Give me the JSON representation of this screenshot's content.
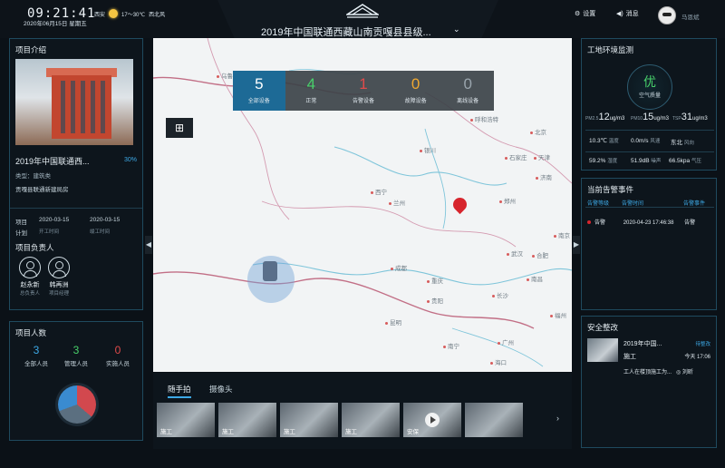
{
  "header": {
    "time": "09:21:41",
    "date": "2020年06月15日 星期五",
    "weather": {
      "city": "西安",
      "temp": "17～30℃",
      "wind": "西北风"
    },
    "title": "2019年中国联通西藏山南贡嘎县县级...",
    "settings_label": "设置",
    "messages_label": "消息",
    "user_name": "马恩斌"
  },
  "project": {
    "panel_title": "项目介绍",
    "name": "2019年中国联通西...",
    "progress": "30%",
    "type": "类型：建筑类",
    "unit": "贡嘎县联通新建局房",
    "item_label": "项目",
    "plan_label": "计划",
    "start_date": "2020-03-15",
    "start_label": "开工时间",
    "end_date": "2020-03-15",
    "end_label": "竣工时间",
    "leaders_title": "项目负责人",
    "leaders": [
      {
        "name": "赵永新",
        "role": "总负责人"
      },
      {
        "name": "韩再洲",
        "role": "项目经理"
      }
    ]
  },
  "people": {
    "panel_title": "项目人数",
    "counts": [
      {
        "value": "3",
        "label": "全部人员",
        "color": "#3da9e6"
      },
      {
        "value": "3",
        "label": "管理人员",
        "color": "#48d06a"
      },
      {
        "value": "0",
        "label": "实施人员",
        "color": "#e04a4a"
      }
    ]
  },
  "device_stats": [
    {
      "value": "5",
      "label": "全部设备",
      "color": "#ffffff"
    },
    {
      "value": "4",
      "label": "正常",
      "color": "#48d06a"
    },
    {
      "value": "1",
      "label": "告警设备",
      "color": "#e04a4a"
    },
    {
      "value": "0",
      "label": "故障设备",
      "color": "#f0a830"
    },
    {
      "value": "0",
      "label": "离线设备",
      "color": "#9aa5ad"
    }
  ],
  "map": {
    "cities": [
      "乌鲁木齐",
      "呼和浩特",
      "北京",
      "天津",
      "石家庄",
      "银川",
      "济南",
      "西宁",
      "兰州",
      "郑州",
      "成都",
      "重庆",
      "武汉",
      "南京",
      "长沙",
      "贵阳",
      "昆明",
      "南宁",
      "广州",
      "福州",
      "南昌",
      "合肥",
      "海口"
    ]
  },
  "media": {
    "tabs": [
      "随手拍",
      "摄像头"
    ],
    "thumbs": [
      "施工",
      "施工",
      "施工",
      "施工",
      "安保",
      ""
    ]
  },
  "environment": {
    "panel_title": "工地环境监测",
    "air_quality_value": "优",
    "air_quality_label": "空气质量",
    "pm25": "12",
    "pm10": "15",
    "pm_other": "31",
    "pm_unit": "ug/m3",
    "pm25_label": "PM2.5",
    "pm10_label": "PM10",
    "tsp_label": "TSP",
    "temperature": "10.3℃",
    "temperature_label": "温度",
    "wind_speed": "0.0m/s",
    "wind_speed_label": "风速",
    "wind_dir": "东北",
    "wind_dir_label": "风向",
    "humidity": "59.2%",
    "humidity_label": "湿度",
    "noise": "51.9dB",
    "noise_label": "噪声",
    "pressure": "66.5kpa",
    "pressure_label": "气压"
  },
  "alarms": {
    "panel_title": "当前告警事件",
    "headers": [
      "告警等级",
      "告警时间",
      "告警事件"
    ],
    "rows": [
      {
        "level": "告警",
        "time": "2020-04-23 17:46:38",
        "event": "告警"
      }
    ]
  },
  "safety": {
    "panel_title": "安全整改",
    "items": [
      {
        "title": "2019年中国...",
        "status": "待整改",
        "type": "施工",
        "time": "今天 17:06",
        "desc": "工人在楼顶施工为...",
        "user": "刘昕"
      }
    ]
  }
}
